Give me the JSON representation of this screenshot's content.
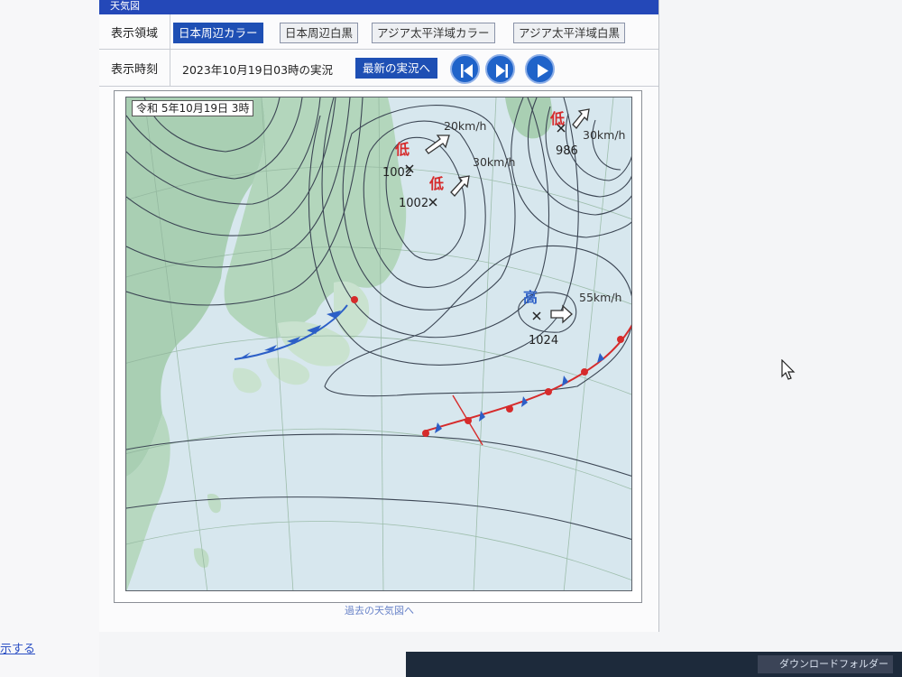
{
  "panel": {
    "title": "天気図",
    "region_label": "表示領域",
    "regions": [
      {
        "label": "日本周辺カラー",
        "active": true
      },
      {
        "label": "日本周辺白黒",
        "active": false
      },
      {
        "label": "アジア太平洋域カラー",
        "active": false
      },
      {
        "label": "アジア太平洋域白黒",
        "active": false
      }
    ],
    "time_label": "表示時刻",
    "time_value": "2023年10月19日03時の実況",
    "latest_button": "最新の実況へ",
    "nav_icons": [
      "skip-first-icon",
      "skip-last-icon",
      "play-icon"
    ],
    "past_link": "過去の天気図へ"
  },
  "map": {
    "date_label": "令和 5年10月19日 3時",
    "lows": [
      {
        "symbol": "低",
        "pressure": "1002",
        "speed": "20km/h"
      },
      {
        "symbol": "低",
        "pressure": "1002",
        "speed": "30km/h"
      },
      {
        "symbol": "低",
        "pressure": "986",
        "speed": "30km/h"
      }
    ],
    "high": {
      "symbol": "高",
      "pressure": "1024",
      "speed": "55km/h"
    },
    "colors": {
      "land": "#a9cfb3",
      "sea": "#d7e7ee",
      "warm_front": "#d62b2b",
      "cold_front": "#2c5fc7"
    }
  },
  "desktop": {
    "left_link": "示する",
    "taskbar_item": "ダウンロードフォルダー"
  }
}
